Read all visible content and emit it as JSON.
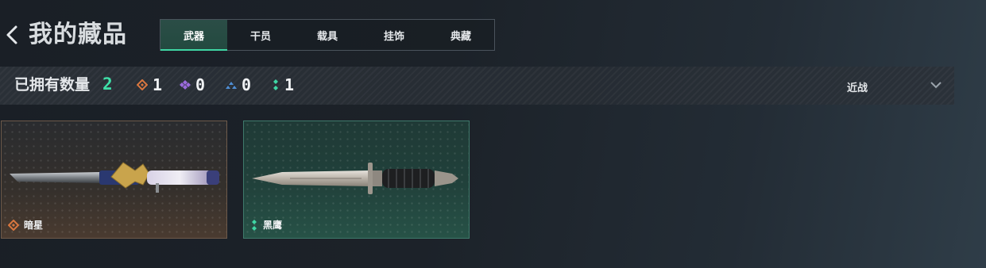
{
  "header": {
    "title": "我的藏品",
    "back_icon": "chevron-left-icon",
    "tabs": [
      {
        "label": "武器",
        "active": true
      },
      {
        "label": "干员",
        "active": false
      },
      {
        "label": "载具",
        "active": false
      },
      {
        "label": "挂饰",
        "active": false
      },
      {
        "label": "典藏",
        "active": false
      }
    ]
  },
  "summary": {
    "owned_label": "已拥有数量",
    "owned_count": "2",
    "rarities": [
      {
        "icon": "orange-diamond-icon",
        "color": "#d9773f",
        "count": "1"
      },
      {
        "icon": "purple-diamond-icon",
        "color": "#9b6bdc",
        "count": "0"
      },
      {
        "icon": "blue-triangle-icon",
        "color": "#4f8fd6",
        "count": "0"
      },
      {
        "icon": "green-dots-icon",
        "color": "#3fd6a4",
        "count": "1"
      }
    ],
    "filter": {
      "selected": "近战",
      "icon": "chevron-down-icon"
    }
  },
  "items": [
    {
      "name": "暗星",
      "rarity_icon": "orange-diamond-icon",
      "rarity_color": "#d9773f",
      "weapon_icon": "ornate-knife-icon"
    },
    {
      "name": "黑鹰",
      "rarity_icon": "green-dots-icon",
      "rarity_color": "#3fd6a4",
      "weapon_icon": "combat-knife-icon"
    }
  ],
  "colors": {
    "accent": "#3fe0a8",
    "active_tab_bg": "#2b4d46",
    "card_orange_border": "#6e5a4a",
    "card_green_border": "#3f7a6b"
  }
}
